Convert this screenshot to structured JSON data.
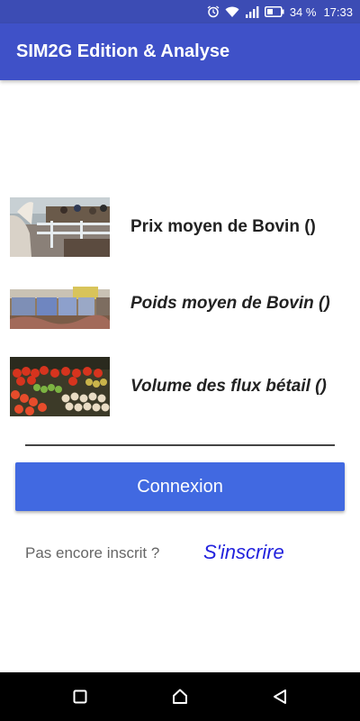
{
  "status_bar": {
    "battery_percent": "34 %",
    "time": "17:33",
    "icons": [
      "alarm-icon",
      "wifi-icon",
      "signal-icon",
      "battery-icon"
    ]
  },
  "app_bar": {
    "title": "SIM2G Edition & Analyse"
  },
  "items": [
    {
      "label": "Prix moyen de Bovin ()",
      "image": "cattle-market-photo"
    },
    {
      "label": "Poids moyen de Bovin ()",
      "image": "livestock-truck-photo"
    },
    {
      "label": "Volume des flux bétail ()",
      "image": "produce-market-photo"
    }
  ],
  "login": {
    "button_label": "Connexion",
    "signup_prompt": "Pas encore inscrit ?",
    "signup_link": "S'inscrire"
  },
  "colors": {
    "status_bar": "#3c4cb4",
    "app_bar": "#3f51c8",
    "button": "#4169e1",
    "link": "#2222dd"
  },
  "nav": {
    "icons": [
      "recent-apps-icon",
      "home-icon",
      "back-icon"
    ]
  }
}
